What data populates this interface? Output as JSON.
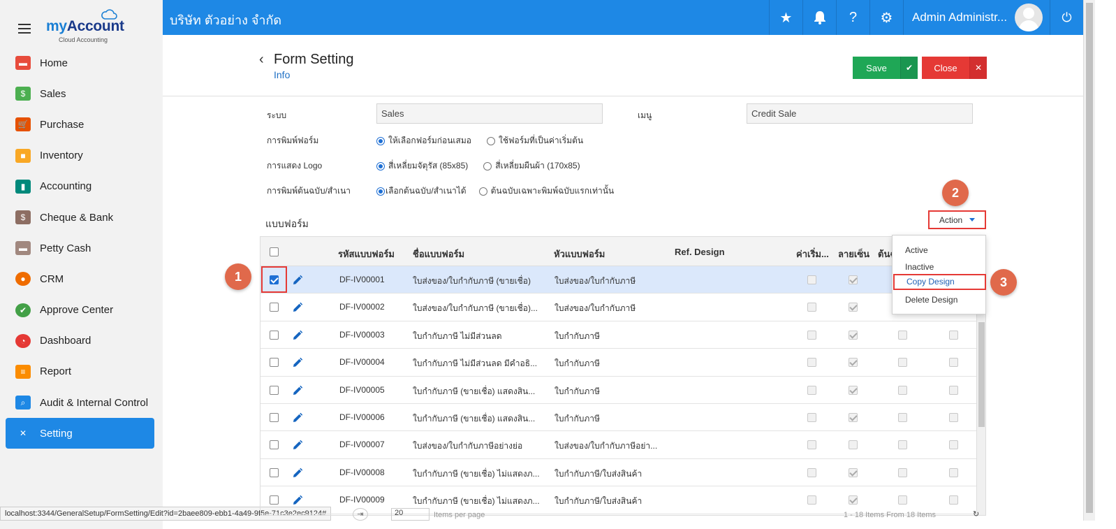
{
  "brand": {
    "name_prefix": "my",
    "name_suffix": "Account",
    "tagline": "Cloud Accounting"
  },
  "sidebar": {
    "items": [
      {
        "label": "Home",
        "icon": "home-icon",
        "color": "#e74c3c"
      },
      {
        "label": "Sales",
        "icon": "money-icon",
        "color": "#4caf50"
      },
      {
        "label": "Purchase",
        "icon": "cart-icon",
        "color": "#e65100"
      },
      {
        "label": "Inventory",
        "icon": "box-icon",
        "color": "#f9a825"
      },
      {
        "label": "Accounting",
        "icon": "book-icon",
        "color": "#00897b"
      },
      {
        "label": "Cheque & Bank",
        "icon": "bank-icon",
        "color": "#8d6e63"
      },
      {
        "label": "Petty Cash",
        "icon": "wallet-icon",
        "color": "#a1887f"
      },
      {
        "label": "CRM",
        "icon": "person-icon",
        "color": "#ef6c00"
      },
      {
        "label": "Approve Center",
        "icon": "check-circle-icon",
        "color": "#43a047"
      },
      {
        "label": "Dashboard",
        "icon": "pie-chart-icon",
        "color": "#e53935"
      },
      {
        "label": "Report",
        "icon": "report-icon",
        "color": "#fb8c00"
      },
      {
        "label": "Audit & Internal Control",
        "icon": "magnifier-icon",
        "color": "#1e88e5"
      },
      {
        "label": "Setting",
        "icon": "tools-icon",
        "color": "#ffffff",
        "active": true
      }
    ]
  },
  "status_url": "localhost:3344/GeneralSetup/FormSetting/Edit?id=2baee809-ebb1-4a49-9f5e-71c3e2ec9124#",
  "topbar": {
    "company": "บริษัท ตัวอย่าง จำกัด",
    "user": "Admin Administr..."
  },
  "header": {
    "title": "Form Setting",
    "subtitle": "Info",
    "save_label": "Save",
    "close_label": "Close"
  },
  "form": {
    "system_label": "ระบบ",
    "system_value": "Sales",
    "menu_label": "เมนู",
    "menu_value": "Credit Sale",
    "print_label": "การพิมพ์ฟอร์ม",
    "print_opt1": "ให้เลือกฟอร์มก่อนเสมอ",
    "print_opt2": "ใช้ฟอร์มที่เป็นค่าเริ่มต้น",
    "logo_label": "การแสดง Logo",
    "logo_opt1": "สี่เหลี่ยมจัตุรัส (85x85)",
    "logo_opt2": "สี่เหลี่ยมผืนผ้า (170x85)",
    "copy_label": "การพิมพ์ต้นฉบับ/สำเนา",
    "copy_opt1": "เลือกต้นฉบับ/สำเนาได้",
    "copy_opt2": "ต้นฉบับเฉพาะพิมพ์ฉบับแรกเท่านั้น"
  },
  "section": {
    "title": "แบบฟอร์ม",
    "action_label": "Action"
  },
  "table": {
    "headers": {
      "code": "รหัสแบบฟอร์ม",
      "name": "ชื่อแบบฟอร์ม",
      "heading": "หัวแบบฟอร์ม",
      "ref": "Ref. Design",
      "default": "ค่าเริ่ม...",
      "sign": "ลายเซ็น",
      "orig": "ต้นฉ"
    },
    "rows": [
      {
        "code": "DF-IV00001",
        "name": "ใบส่งของ/ใบกำกับภาษี (ขายเชื่อ)",
        "heading": "ใบส่งของ/ใบกำกับภาษี",
        "selected": true,
        "sign": true
      },
      {
        "code": "DF-IV00002",
        "name": "ใบส่งของ/ใบกำกับภาษี (ขายเชื่อ)...",
        "heading": "ใบส่งของ/ใบกำกับภาษี",
        "selected": false,
        "sign": true
      },
      {
        "code": "DF-IV00003",
        "name": "ใบกำกับภาษี ไม่มีส่วนลด",
        "heading": "ใบกำกับภาษี",
        "selected": false,
        "sign": true
      },
      {
        "code": "DF-IV00004",
        "name": "ใบกำกับภาษี ไม่มีส่วนลด มีคำอธิ...",
        "heading": "ใบกำกับภาษี",
        "selected": false,
        "sign": true
      },
      {
        "code": "DF-IV00005",
        "name": "ใบกำกับภาษี (ขายเชื่อ) แสดงสิน...",
        "heading": "ใบกำกับภาษี",
        "selected": false,
        "sign": true
      },
      {
        "code": "DF-IV00006",
        "name": "ใบกำกับภาษี (ขายเชื่อ) แสดงสิน...",
        "heading": "ใบกำกับภาษี",
        "selected": false,
        "sign": true
      },
      {
        "code": "DF-IV00007",
        "name": "ใบส่งของ/ใบกำกับภาษีอย่างย่อ",
        "heading": "ใบส่งของ/ใบกำกับภาษีอย่า...",
        "selected": false,
        "sign": false
      },
      {
        "code": "DF-IV00008",
        "name": "ใบกำกับภาษี (ขายเชื่อ) ไม่แสดงภ...",
        "heading": "ใบกำกับภาษี/ใบส่งสินค้า",
        "selected": false,
        "sign": true
      },
      {
        "code": "DF-IV00009",
        "name": "ใบกำกับภาษี (ขายเชื่อ) ไม่แสดงภ...",
        "heading": "ใบกำกับภาษี/ใบส่งสินค้า",
        "selected": false,
        "sign": true
      }
    ]
  },
  "dropdown": {
    "items": [
      "Active",
      "Inactive",
      "Copy Design",
      "Delete Design"
    ]
  },
  "markers": {
    "m1": "1",
    "m2": "2",
    "m3": "3"
  },
  "pager": {
    "page_size": "20",
    "items_per_page": "Items per page",
    "summary": "1 - 18 Items From 18 Items"
  }
}
